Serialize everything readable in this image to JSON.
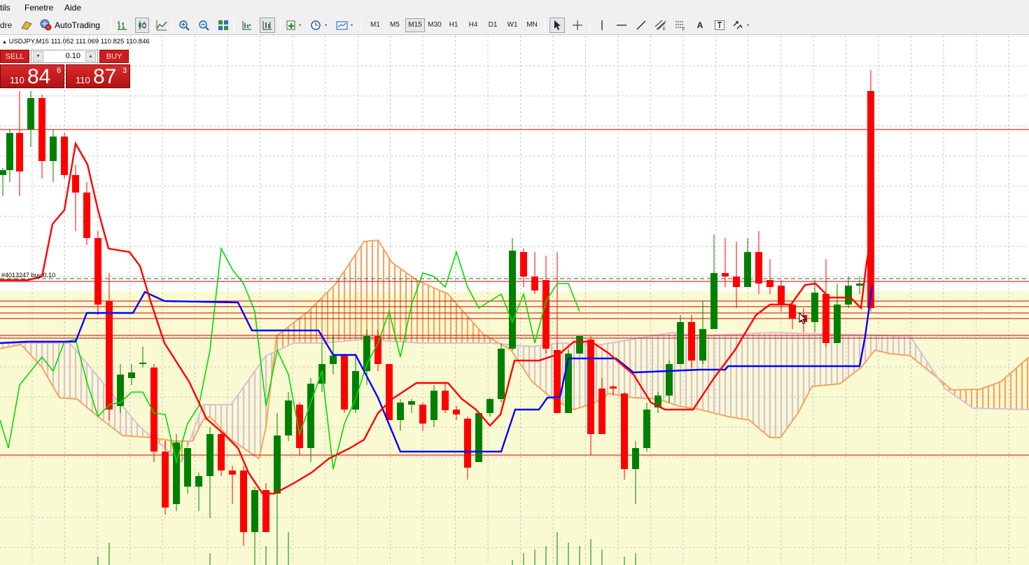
{
  "menu": {
    "items": [
      "tils",
      "Fenetre",
      "Aide"
    ]
  },
  "toolbar": {
    "partial_label": "dre",
    "autotrading_label": "AutoTrading",
    "timeframes": [
      "M1",
      "M5",
      "M15",
      "M30",
      "H1",
      "H4",
      "D1",
      "W1",
      "MN"
    ],
    "active_timeframe": "M15"
  },
  "chart": {
    "symbol_info": "USDJPY,M15  111.052 111.069 110.825 110.846",
    "order_label": "#4013247 buy 0.10",
    "colors": {
      "background": "#ffffff",
      "zone": "#fafad2",
      "bull": "#008000",
      "bear": "#ff0000",
      "tenkan": "#ff0000",
      "kijun": "#0000ff",
      "chikou": "#00dd00",
      "cloud_up": "#f4a460",
      "cloud_down": "#d8bfd8"
    }
  },
  "trade_panel": {
    "sell_label": "SELL",
    "buy_label": "BUY",
    "lot": "0.10",
    "sell_price": {
      "prefix": "110",
      "big": "84",
      "sup": "6"
    },
    "buy_price": {
      "prefix": "110",
      "big": "87",
      "sup": "3"
    }
  }
}
